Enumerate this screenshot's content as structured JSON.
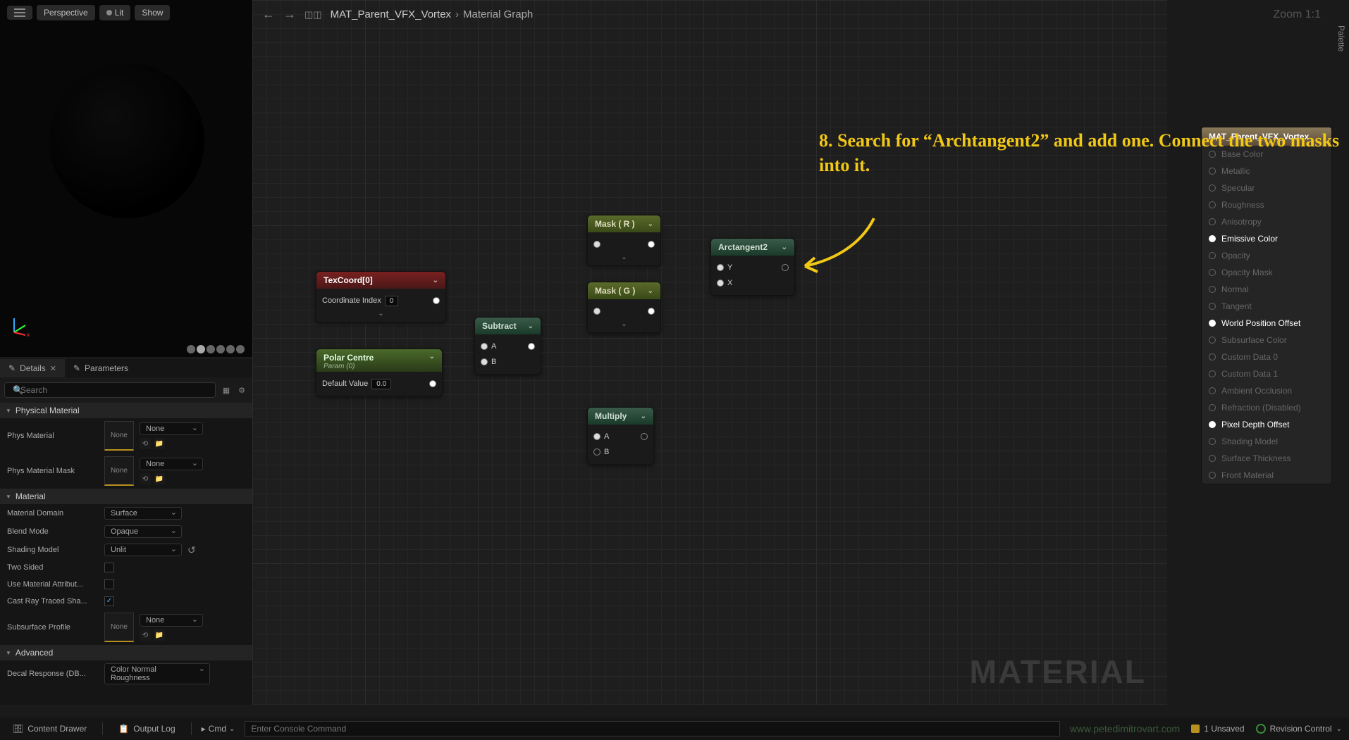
{
  "viewport": {
    "perspective": "Perspective",
    "lit": "Lit",
    "show": "Show"
  },
  "breadcrumb": {
    "asset": "MAT_Parent_VFX_Vortex",
    "sub": "Material Graph"
  },
  "zoom": "Zoom 1:1",
  "palette": "Palette",
  "tabs": {
    "details": "Details",
    "parameters": "Parameters"
  },
  "search": {
    "placeholder": "Search"
  },
  "sections": {
    "phys": "Physical Material",
    "mat": "Material",
    "adv": "Advanced"
  },
  "props": {
    "phys_material": {
      "label": "Phys Material",
      "thumb": "None",
      "val": "None"
    },
    "phys_mask": {
      "label": "Phys Material Mask",
      "thumb": "None",
      "val": "None"
    },
    "domain": {
      "label": "Material Domain",
      "val": "Surface"
    },
    "blend": {
      "label": "Blend Mode",
      "val": "Opaque"
    },
    "shading": {
      "label": "Shading Model",
      "val": "Unlit"
    },
    "two_sided": {
      "label": "Two Sided"
    },
    "use_attr": {
      "label": "Use Material Attribut..."
    },
    "cast_ray": {
      "label": "Cast Ray Traced Sha..."
    },
    "subsurface": {
      "label": "Subsurface Profile",
      "thumb": "None",
      "val": "None"
    },
    "decal": {
      "label": "Decal Response (DB...",
      "val": "Color Normal Roughness"
    }
  },
  "nodes": {
    "texcoord": {
      "title": "TexCoord[0]",
      "p1": "Coordinate Index",
      "p1v": "0"
    },
    "polar": {
      "title": "Polar Centre",
      "sub": "Param (0)",
      "p1": "Default Value",
      "p1v": "0.0"
    },
    "subtract": {
      "title": "Subtract",
      "a": "A",
      "b": "B"
    },
    "mask_r": {
      "title": "Mask ( R )"
    },
    "mask_g": {
      "title": "Mask ( G )"
    },
    "multiply": {
      "title": "Multiply",
      "a": "A",
      "b": "B"
    },
    "arctan": {
      "title": "Arctangent2",
      "y": "Y",
      "x": "X"
    }
  },
  "output": {
    "title": "MAT_Parent_VFX_Vortex",
    "pins": [
      {
        "label": "Base Color",
        "active": false
      },
      {
        "label": "Metallic",
        "active": false
      },
      {
        "label": "Specular",
        "active": false
      },
      {
        "label": "Roughness",
        "active": false
      },
      {
        "label": "Anisotropy",
        "active": false
      },
      {
        "label": "Emissive Color",
        "active": true
      },
      {
        "label": "Opacity",
        "active": false
      },
      {
        "label": "Opacity Mask",
        "active": false
      },
      {
        "label": "Normal",
        "active": false
      },
      {
        "label": "Tangent",
        "active": false
      },
      {
        "label": "World Position Offset",
        "active": true
      },
      {
        "label": "Subsurface Color",
        "active": false
      },
      {
        "label": "Custom Data 0",
        "active": false
      },
      {
        "label": "Custom Data 1",
        "active": false
      },
      {
        "label": "Ambient Occlusion",
        "active": false
      },
      {
        "label": "Refraction (Disabled)",
        "active": false
      },
      {
        "label": "Pixel Depth Offset",
        "active": true
      },
      {
        "label": "Shading Model",
        "active": false
      },
      {
        "label": "Surface Thickness",
        "active": false
      },
      {
        "label": "Front Material",
        "active": false
      }
    ]
  },
  "annotation": "8. Search for “Archtangent2” and add one. Connect the two masks into it.",
  "watermark": "MATERIAL",
  "bottom": {
    "content_drawer": "Content Drawer",
    "output_log": "Output Log",
    "cmd": "Cmd",
    "cmd_placeholder": "Enter Console Command",
    "url": "www.petedimitrovart.com",
    "unsaved": "1 Unsaved",
    "revision": "Revision Control"
  }
}
